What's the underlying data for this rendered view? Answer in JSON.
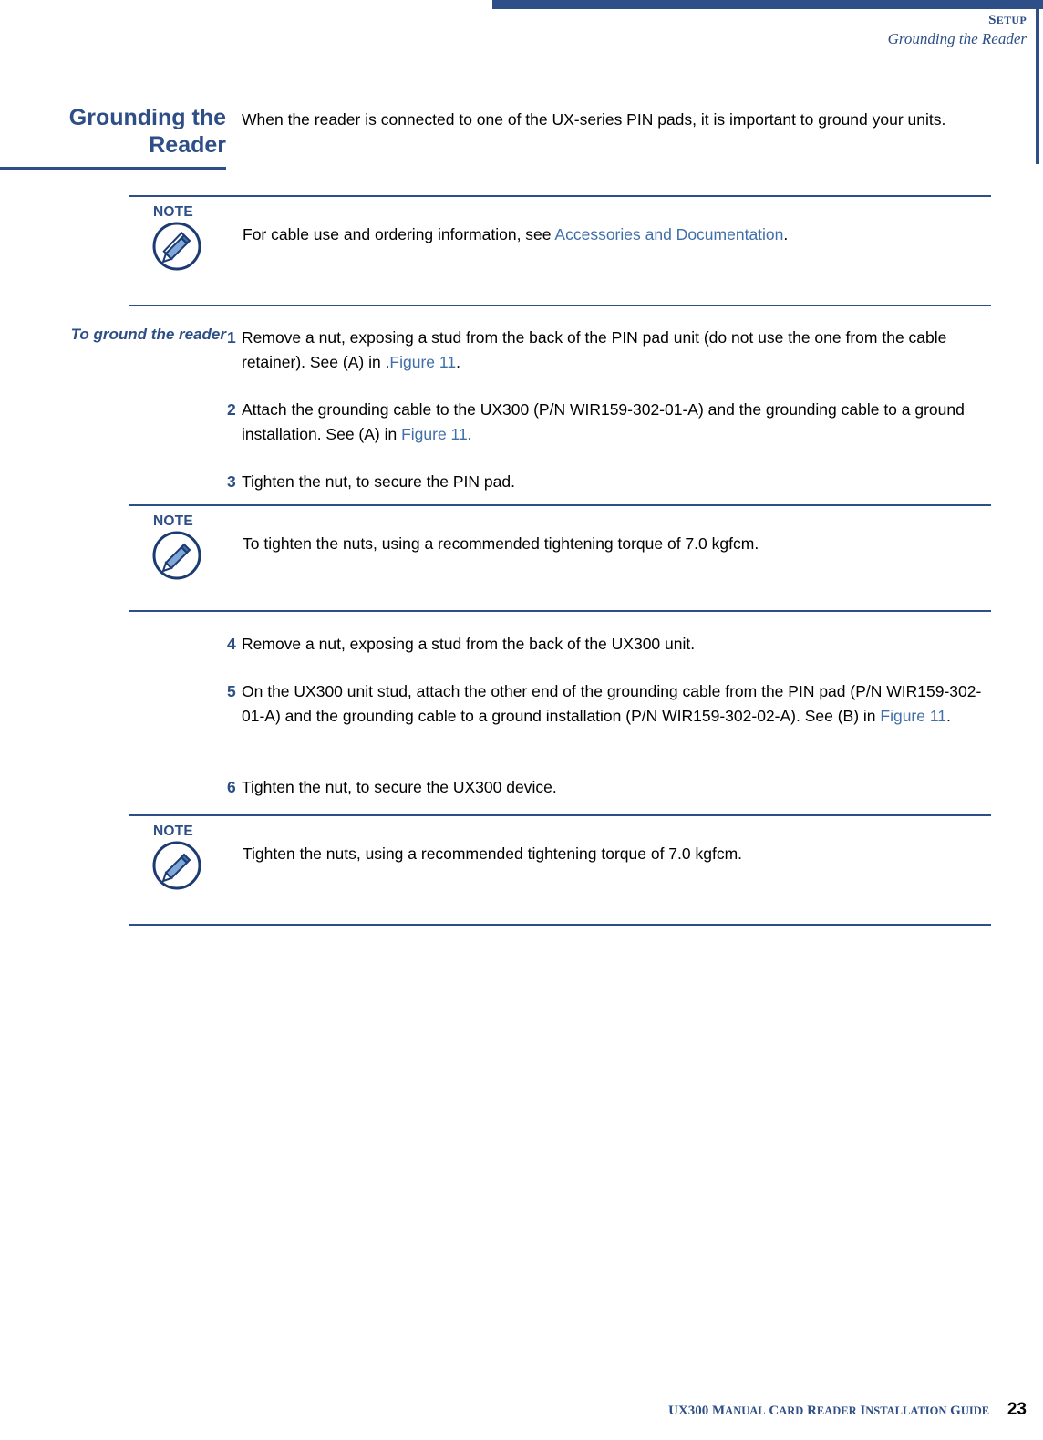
{
  "header": {
    "chapter": "SETUP",
    "chapter_caps_first": "S",
    "chapter_caps_rest": "ETUP",
    "subtitle": "Grounding the Reader"
  },
  "section": {
    "title_line1": "Grounding the",
    "title_line2": "Reader",
    "intro": "When the reader is connected to one of the UX-series PIN pads, it is important to ground your units.",
    "procedure_label": "To ground the reader"
  },
  "notes": [
    {
      "label": "NOTE",
      "text_before": "For cable use and ordering information, see ",
      "link": "Accessories and Documentation",
      "text_after": "."
    },
    {
      "label": "NOTE",
      "text_before": "To tighten the nuts, using a recommended tightening torque of 7.0 kgfcm.",
      "link": "",
      "text_after": ""
    },
    {
      "label": "NOTE",
      "text_before": "Tighten the nuts, using a recommended tightening torque of 7.0 kgfcm.",
      "link": "",
      "text_after": ""
    }
  ],
  "steps": [
    {
      "num": "1",
      "before": "Remove a nut, exposing a stud from the back of the PIN pad unit (do not use the one from the cable retainer). See (A) in .",
      "seg1": "Remove a nut, exposing a stud from the back of the PIN pad unit (do not use the one from the cable retainer). See (A) in .",
      "link": "Figure 11",
      "after": "."
    },
    {
      "num": "2",
      "seg1": "Attach the grounding cable to the UX300 (P/N WIR159-302-01-A) and the grounding cable to a ground installation. See (A) in ",
      "link": "Figure 11",
      "after": "."
    },
    {
      "num": "3",
      "seg1": "Tighten the nut, to secure the PIN pad.",
      "link": "",
      "after": ""
    },
    {
      "num": "4",
      "seg1": "Remove a nut, exposing a stud from the back of the UX300 unit.",
      "link": "",
      "after": ""
    },
    {
      "num": "5",
      "seg1": "On the UX300 unit stud, attach the other end of the grounding cable from the PIN pad (P/N WIR159-302-01-A) and the grounding cable to a ground installation (P/N WIR159-302-02-A). See (B) in ",
      "link": "Figure 11",
      "after": "."
    },
    {
      "num": "6",
      "seg1": "Tighten the nut, to secure the UX300 device.",
      "link": "",
      "after": ""
    }
  ],
  "footer": {
    "text_ux": "UX300 M",
    "text_anual": "ANUAL",
    "text_c": " C",
    "text_ard": "ARD",
    "text_r": " R",
    "text_eader": "EADER",
    "text_i": " I",
    "text_nstallation": "NSTALLATION",
    "text_g": " G",
    "text_uide": "UIDE",
    "page": "23"
  },
  "colors": {
    "accent": "#2d4e86",
    "link": "#3f6ea8"
  }
}
